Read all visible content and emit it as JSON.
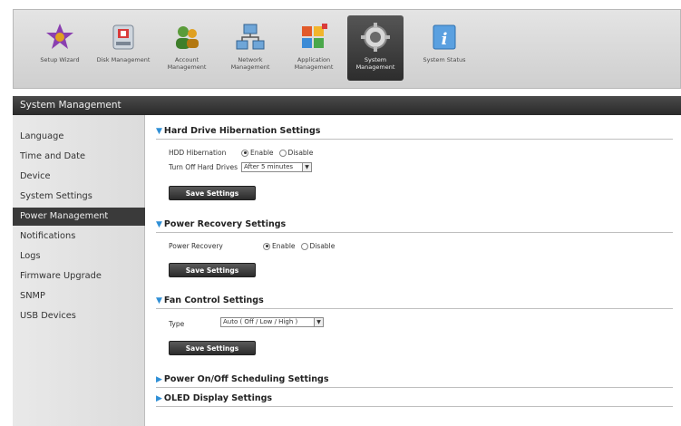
{
  "nav": {
    "items": [
      {
        "label": "Setup Wizard",
        "icon": "wand-icon"
      },
      {
        "label": "Disk Management",
        "icon": "disk-icon"
      },
      {
        "label": "Account Management",
        "icon": "users-icon"
      },
      {
        "label": "Network Management",
        "icon": "network-icon"
      },
      {
        "label": "Application Management",
        "icon": "apps-icon"
      },
      {
        "label": "System Management",
        "icon": "system-icon",
        "active": true
      },
      {
        "label": "System Status",
        "icon": "info-icon"
      }
    ]
  },
  "header": {
    "title": "System Management"
  },
  "sidebar": {
    "items": [
      {
        "label": "Language"
      },
      {
        "label": "Time and Date"
      },
      {
        "label": "Device"
      },
      {
        "label": "System Settings"
      },
      {
        "label": "Power Management",
        "active": true
      },
      {
        "label": "Notifications"
      },
      {
        "label": "Logs"
      },
      {
        "label": "Firmware Upgrade"
      },
      {
        "label": "SNMP"
      },
      {
        "label": "USB Devices"
      }
    ]
  },
  "hibernation": {
    "title": "Hard Drive Hibernation Settings",
    "hdd_label": "HDD Hibernation",
    "enable": "Enable",
    "disable": "Disable",
    "selected": "Enable",
    "turnoff_label": "Turn Off Hard Drives",
    "turnoff_value": "After 5 minutes",
    "save": "Save Settings"
  },
  "recovery": {
    "title": "Power Recovery Settings",
    "label": "Power Recovery",
    "enable": "Enable",
    "disable": "Disable",
    "selected": "Enable",
    "save": "Save Settings"
  },
  "fan": {
    "title": "Fan Control Settings",
    "type_label": "Type",
    "type_value": "Auto ( Off / Low / High )",
    "save": "Save Settings"
  },
  "scheduling": {
    "title": "Power On/Off Scheduling Settings"
  },
  "oled": {
    "title": "OLED Display Settings"
  },
  "colors": {
    "accent": "#2f8fd6",
    "dark_bar": "#2a2a2a"
  }
}
